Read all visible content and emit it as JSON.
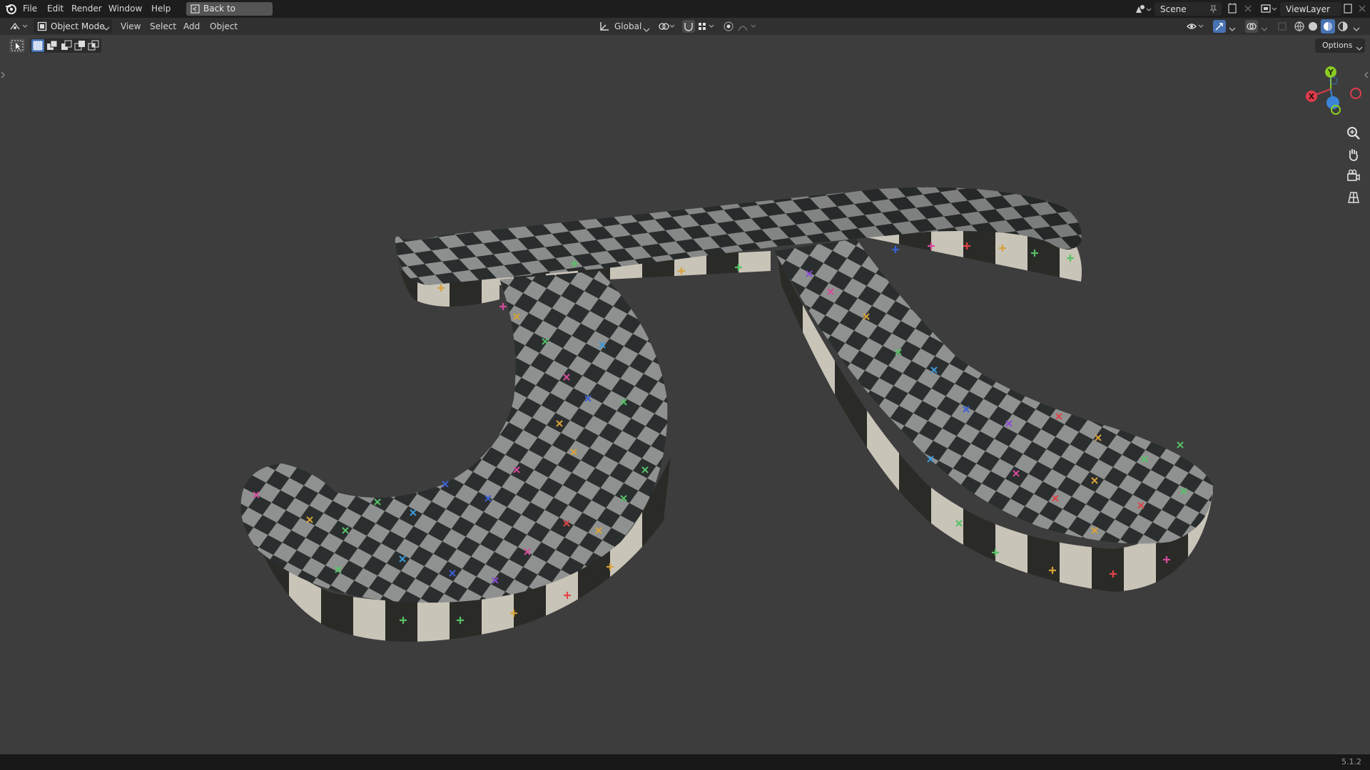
{
  "menu": {
    "items": [
      "File",
      "Edit",
      "Render",
      "Window",
      "Help"
    ],
    "back_label": "Back to Previous"
  },
  "scene": {
    "name": "Scene"
  },
  "viewlayer": {
    "name": "ViewLayer"
  },
  "header": {
    "mode": "Object Mode",
    "menus": [
      "View",
      "Select",
      "Add",
      "Object"
    ],
    "orientation": "Global",
    "options_label": "Options"
  },
  "status": {
    "version": "5.1.2"
  },
  "gizmo": {
    "x": "X",
    "y": "Y"
  },
  "colors": {
    "axis_x": "#e23c4c",
    "axis_y": "#8ccc22",
    "axis_z": "#3b84d8",
    "active_blue": "#4772b3"
  }
}
